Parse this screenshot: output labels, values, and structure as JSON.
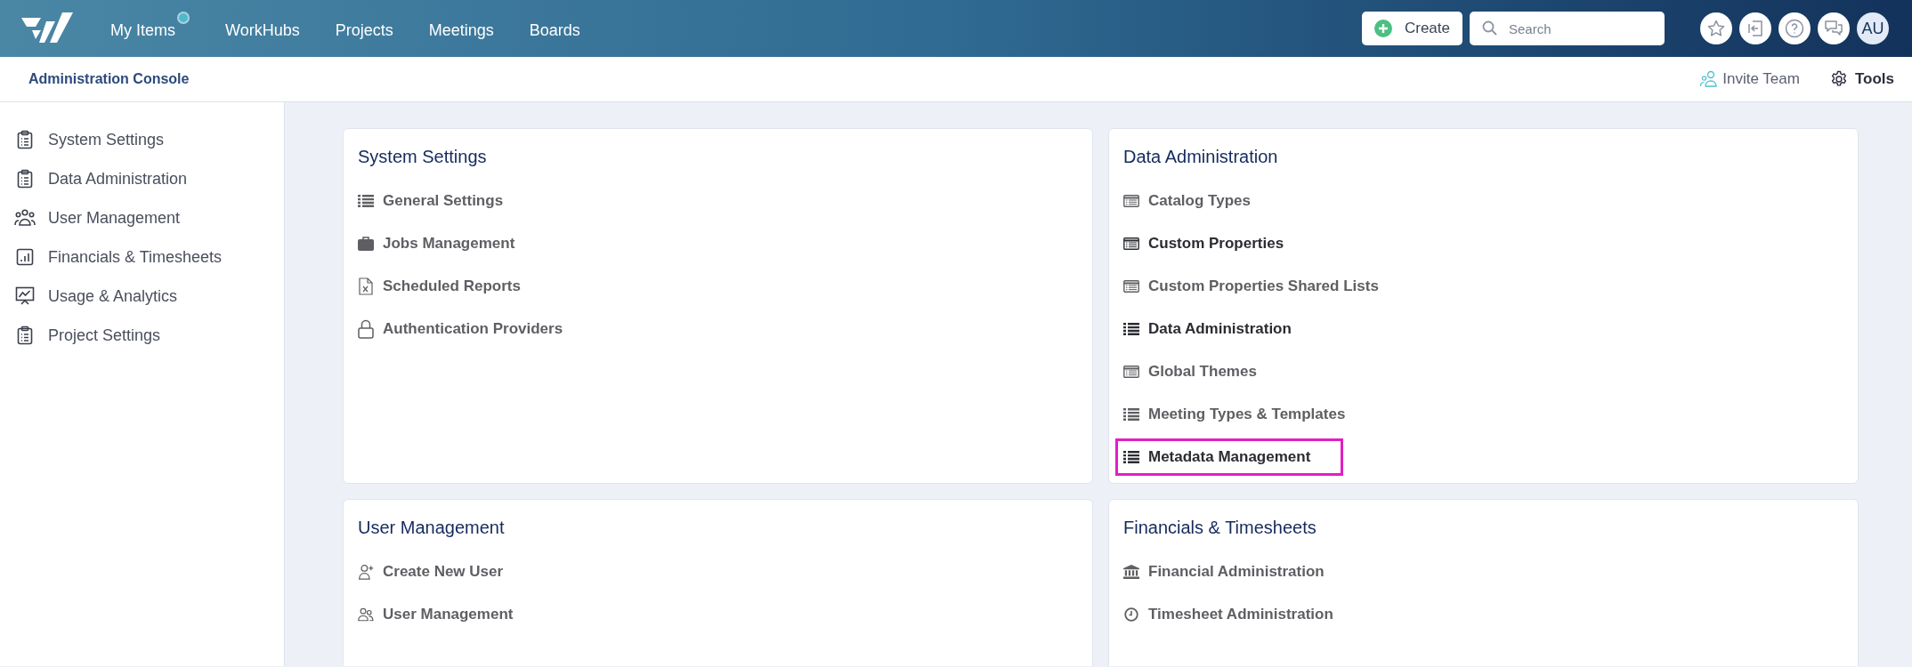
{
  "top_nav": {
    "items": [
      {
        "label": "My Items",
        "badge": true
      },
      {
        "label": "WorkHubs",
        "badge": false
      },
      {
        "label": "Projects",
        "badge": false
      },
      {
        "label": "Meetings",
        "badge": false
      },
      {
        "label": "Boards",
        "badge": false
      }
    ],
    "create_button": "Create",
    "search": {
      "placeholder": "Search"
    },
    "avatar": "AU"
  },
  "sub_header": {
    "title": "Administration Console",
    "invite": "Invite Team",
    "tools": "Tools"
  },
  "sidebar": {
    "items": [
      {
        "label": "System Settings",
        "kind": "clipboard"
      },
      {
        "label": "Data Administration",
        "kind": "clipboard"
      },
      {
        "label": "User Management",
        "kind": "group"
      },
      {
        "label": "Financials & Timesheets",
        "kind": "chart"
      },
      {
        "label": "Usage & Analytics",
        "kind": "presentation"
      },
      {
        "label": "Project Settings",
        "kind": "clipboard"
      }
    ]
  },
  "cards": [
    {
      "title": "System Settings",
      "items": [
        {
          "label": "General Settings",
          "kind": "list",
          "emphasized": false,
          "outlined": false
        },
        {
          "label": "Jobs Management",
          "kind": "briefcase",
          "emphasized": false,
          "outlined": false
        },
        {
          "label": "Scheduled Reports",
          "kind": "file-x",
          "emphasized": false,
          "outlined": false
        },
        {
          "label": "Authentication Providers",
          "kind": "lock",
          "emphasized": false,
          "outlined": false
        }
      ]
    },
    {
      "title": "Data Administration",
      "items": [
        {
          "label": "Catalog Types",
          "kind": "table",
          "emphasized": false,
          "outlined": false
        },
        {
          "label": "Custom Properties",
          "kind": "table",
          "emphasized": true,
          "outlined": false
        },
        {
          "label": "Custom Properties Shared Lists",
          "kind": "table",
          "emphasized": false,
          "outlined": false
        },
        {
          "label": "Data Administration",
          "kind": "list",
          "emphasized": true,
          "outlined": false
        },
        {
          "label": "Global Themes",
          "kind": "table",
          "emphasized": false,
          "outlined": false
        },
        {
          "label": "Meeting Types & Templates",
          "kind": "list",
          "emphasized": false,
          "outlined": false
        },
        {
          "label": "Metadata Management",
          "kind": "list",
          "emphasized": true,
          "outlined": true
        }
      ]
    },
    {
      "title": "User Management",
      "items": [
        {
          "label": "Create New User",
          "kind": "user-plus",
          "emphasized": false,
          "outlined": false
        },
        {
          "label": "User Management",
          "kind": "users",
          "emphasized": false,
          "outlined": false
        }
      ]
    },
    {
      "title": "Financials & Timesheets",
      "items": [
        {
          "label": "Financial Administration",
          "kind": "bank",
          "emphasized": false,
          "outlined": false
        },
        {
          "label": "Timesheet Administration",
          "kind": "clock",
          "emphasized": false,
          "outlined": false
        }
      ]
    }
  ]
}
